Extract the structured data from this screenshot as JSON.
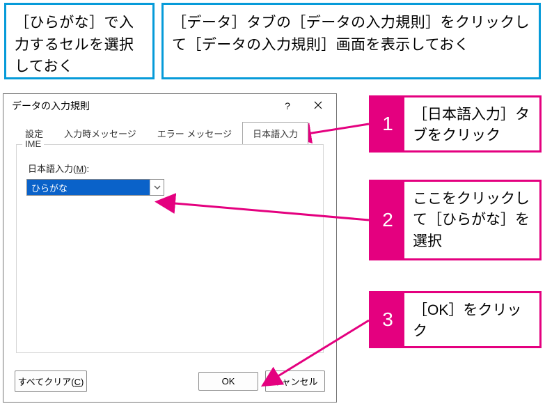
{
  "top_left": "［ひらがな］で入力するセルを選択しておく",
  "top_right": "［データ］タブの［データの入力規則］をクリックして［データの入力規則］画面を表示しておく",
  "dialog": {
    "title": "データの入力規則",
    "help": "?",
    "tabs": [
      "設定",
      "入力時メッセージ",
      "エラー メッセージ",
      "日本語入力"
    ],
    "active_tab": 3,
    "group_label": "IME",
    "field_label_pre": "日本語入力(",
    "field_label_u": "M",
    "field_label_post": "):",
    "combo_value": "ひらがな",
    "clear_pre": "すべてクリア(",
    "clear_u": "C",
    "clear_post": ")",
    "ok": "OK",
    "cancel": "キャンセル"
  },
  "callouts": {
    "c1_num": "1",
    "c1_txt": "［日本語入力］タブをクリック",
    "c2_num": "2",
    "c2_txt": "ここをクリックして［ひらがな］を選択",
    "c3_num": "3",
    "c3_txt": "［OK］をクリック"
  }
}
